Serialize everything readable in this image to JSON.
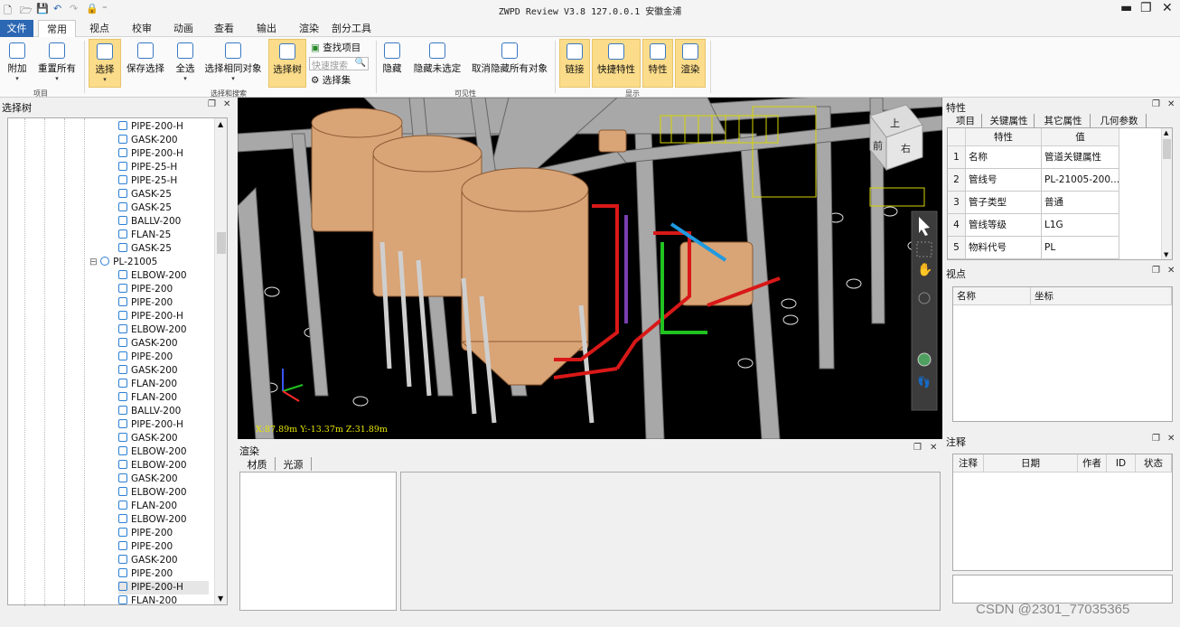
{
  "window": {
    "title": "ZWPD Review V3.8 127.0.0.1 安徽金浦"
  },
  "tabs": [
    "文件",
    "常用",
    "视点",
    "校审",
    "动画",
    "查看",
    "输出",
    "渲染",
    "剖分工具"
  ],
  "ribbon": {
    "buttons": {
      "attach": "附加",
      "reset_all": "重置所有",
      "select": "选择",
      "save_select": "保存选择",
      "select_all": "全选",
      "select_same": "选择相同对象",
      "select_tree": "选择树",
      "find_items": "查找项目",
      "quick_search_placeholder": "快速搜索",
      "selection_sets": "选择集",
      "hide": "隐藏",
      "hide_unselected": "隐藏未选定",
      "unhide_all": "取消隐藏所有对象",
      "links": "链接",
      "quick_props": "快捷特性",
      "properties": "特性",
      "render": "渲染"
    },
    "groups": {
      "project": "项目",
      "select_search": "选择和搜索",
      "visibility": "可见性",
      "display": "显示"
    }
  },
  "tree": {
    "title": "选择树",
    "items_before": [
      "PIPE-200-H",
      "GASK-200",
      "PIPE-200-H",
      "PIPE-25-H",
      "PIPE-25-H",
      "GASK-25",
      "GASK-25",
      "BALLV-200",
      "FLAN-25",
      "GASK-25"
    ],
    "group": "PL-21005",
    "items_after": [
      "ELBOW-200",
      "PIPE-200",
      "PIPE-200",
      "PIPE-200-H",
      "ELBOW-200",
      "GASK-200",
      "PIPE-200",
      "GASK-200",
      "FLAN-200",
      "FLAN-200",
      "BALLV-200",
      "PIPE-200-H",
      "GASK-200",
      "ELBOW-200",
      "ELBOW-200",
      "GASK-200",
      "ELBOW-200",
      "FLAN-200",
      "ELBOW-200",
      "PIPE-200",
      "PIPE-200",
      "GASK-200",
      "PIPE-200",
      "PIPE-200-H",
      "FLAN-200"
    ]
  },
  "viewport": {
    "coords": "X:87.89m  Y:-13.37m  Z:31.89m",
    "cube": {
      "top": "上",
      "front": "前",
      "right": "右"
    }
  },
  "render_panel": {
    "title": "渲染",
    "tabs": [
      "材质",
      "光源"
    ]
  },
  "properties_panel": {
    "title": "特性",
    "tabs": [
      "项目",
      "关键属性",
      "其它属性",
      "几何参数"
    ],
    "columns": [
      "特性",
      "值"
    ],
    "rows": [
      {
        "n": "1",
        "name": "名称",
        "value": "管道关键属性"
      },
      {
        "n": "2",
        "name": "管线号",
        "value": "PL-21005-200..."
      },
      {
        "n": "3",
        "name": "管子类型",
        "value": "普通"
      },
      {
        "n": "4",
        "name": "管线等级",
        "value": "L1G"
      },
      {
        "n": "5",
        "name": "物料代号",
        "value": "PL"
      }
    ]
  },
  "viewpoint_panel": {
    "title": "视点",
    "columns": [
      "名称",
      "坐标"
    ]
  },
  "notes_panel": {
    "title": "注释",
    "columns": [
      "注释",
      "日期",
      "作者",
      "ID",
      "状态"
    ]
  },
  "watermark": "CSDN @2301_77035365",
  "colors": {
    "file_tab": "#2b67b3",
    "selected_button": "#fbdc8a",
    "viewport_bg": "#000000"
  }
}
